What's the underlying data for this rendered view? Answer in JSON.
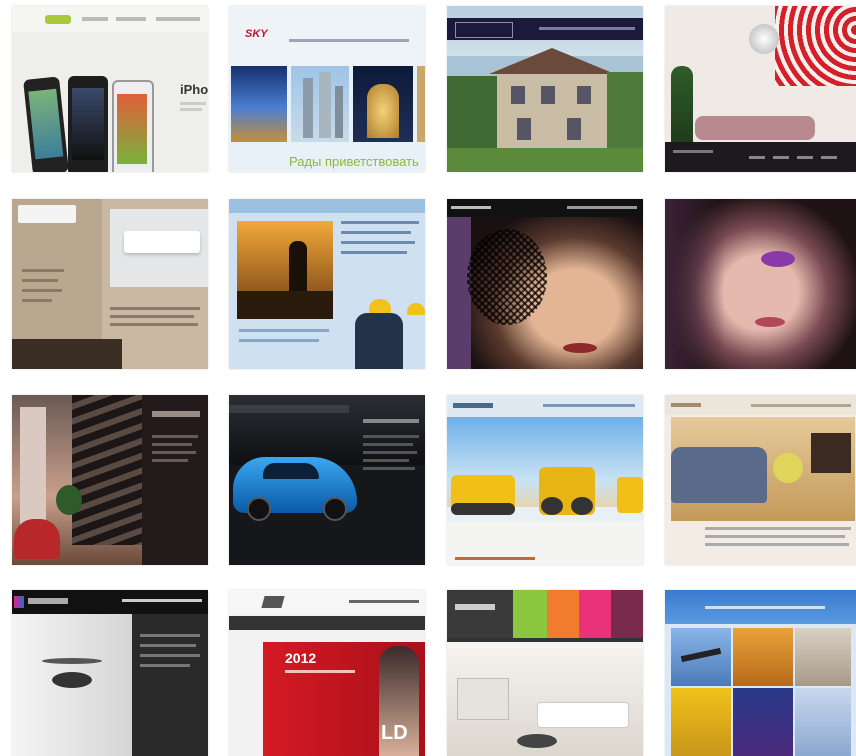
{
  "thumbs": {
    "iphone": {
      "brand": "iPhone"
    },
    "construction": {
      "logo": "SKY",
      "tagline": "Рады приветствовать"
    },
    "salon": {
      "year": "2012",
      "letters": "LD"
    }
  }
}
